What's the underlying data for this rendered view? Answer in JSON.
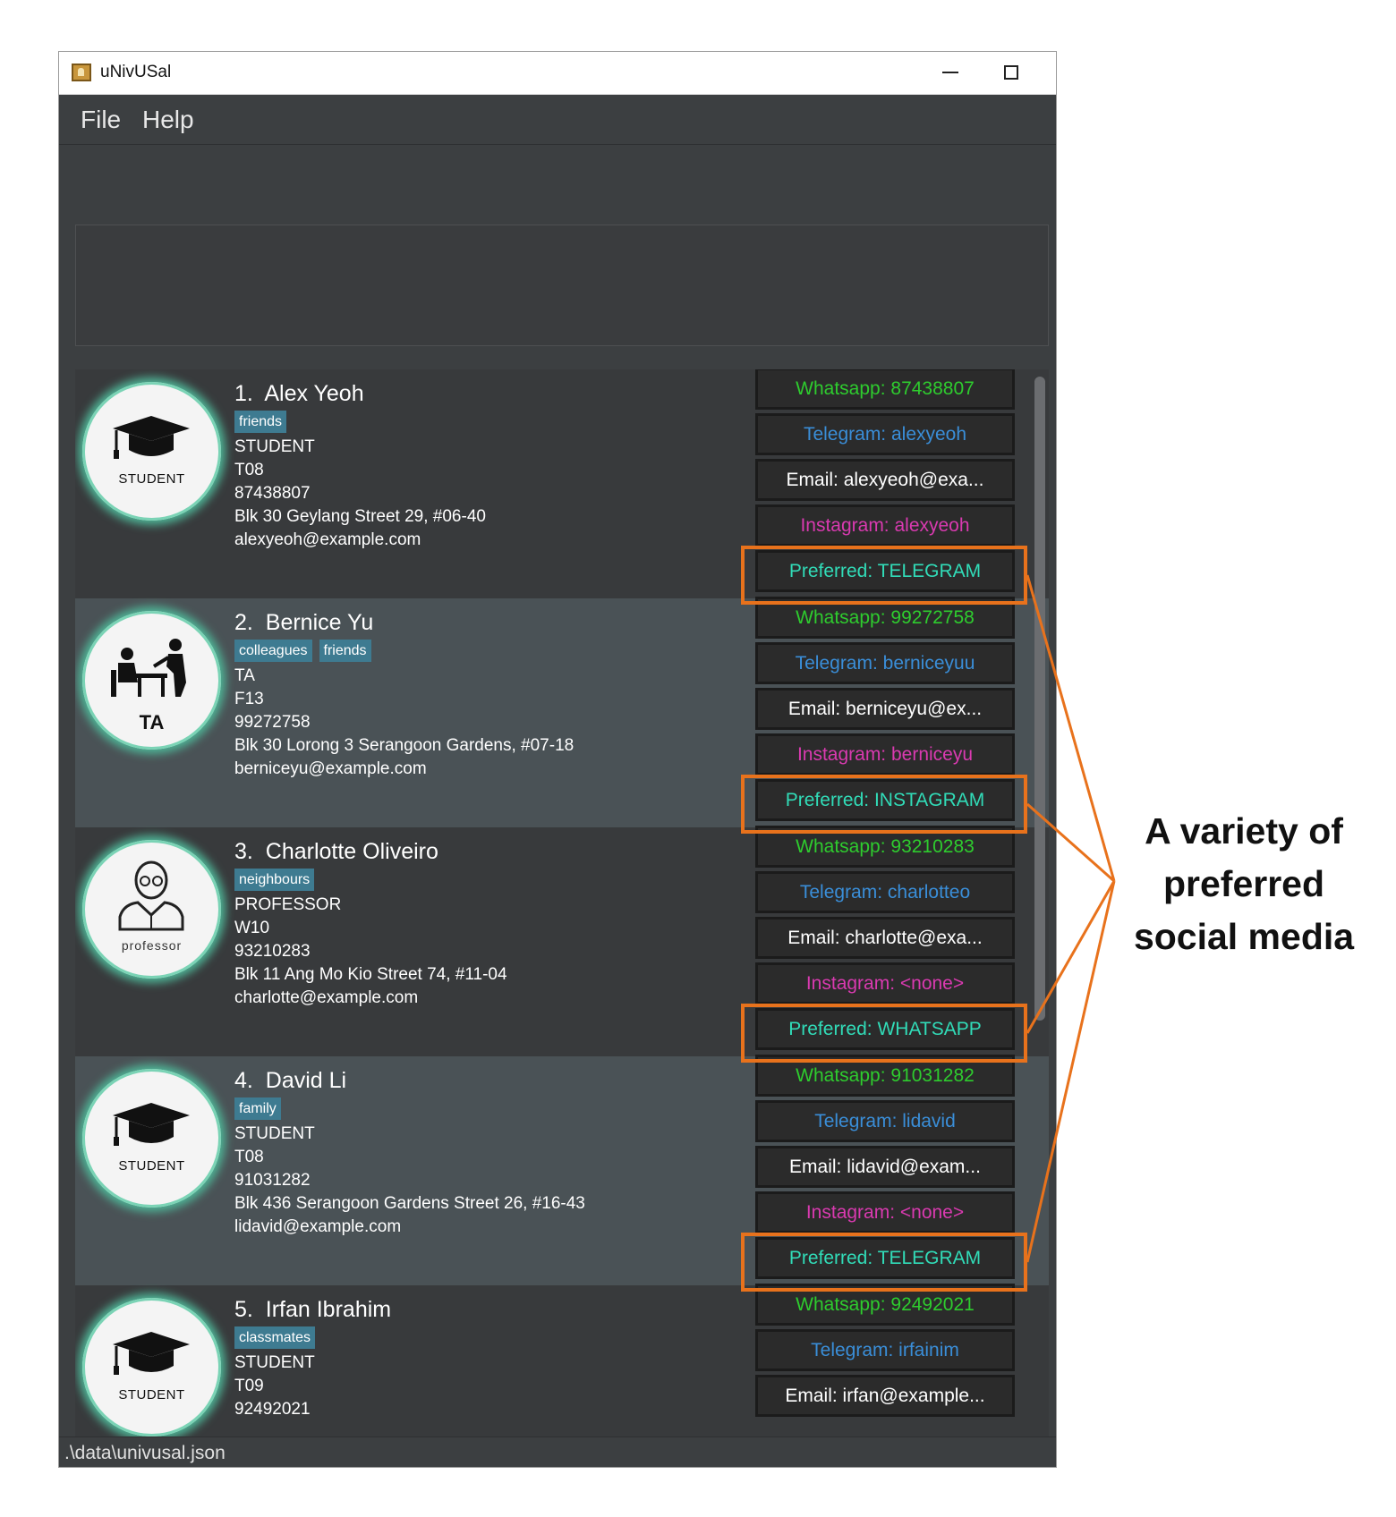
{
  "window": {
    "title": "uNivUSal"
  },
  "menu": {
    "file": "File",
    "help": "Help"
  },
  "contacts": [
    {
      "index": "1.",
      "name": "Alex Yeoh",
      "tags": [
        "friends"
      ],
      "role": "STUDENT",
      "group": "T08",
      "phone": "87438807",
      "address": "Blk 30 Geylang Street 29, #06-40",
      "email": "alexyeoh@example.com",
      "avatar_label": "STUDENT",
      "social": {
        "whatsapp": "Whatsapp: 87438807",
        "telegram": "Telegram: alexyeoh",
        "email": "Email: alexyeoh@exa...",
        "instagram": "Instagram: alexyeoh",
        "preferred": "Preferred: TELEGRAM"
      }
    },
    {
      "index": "2.",
      "name": "Bernice Yu",
      "tags": [
        "colleagues",
        "friends"
      ],
      "role": "TA",
      "group": "F13",
      "phone": "99272758",
      "address": "Blk 30 Lorong 3 Serangoon Gardens, #07-18",
      "email": "berniceyu@example.com",
      "avatar_label": "TA",
      "social": {
        "whatsapp": "Whatsapp: 99272758",
        "telegram": "Telegram: berniceyuu",
        "email": "Email: berniceyu@ex...",
        "instagram": "Instagram: berniceyu",
        "preferred": "Preferred: INSTAGRAM"
      }
    },
    {
      "index": "3.",
      "name": "Charlotte Oliveiro",
      "tags": [
        "neighbours"
      ],
      "role": "PROFESSOR",
      "group": "W10",
      "phone": "93210283",
      "address": "Blk 11 Ang Mo Kio Street 74, #11-04",
      "email": "charlotte@example.com",
      "avatar_label": "professor",
      "social": {
        "whatsapp": "Whatsapp: 93210283",
        "telegram": "Telegram: charlotteo",
        "email": "Email: charlotte@exa...",
        "instagram": "Instagram: <none>",
        "preferred": "Preferred: WHATSAPP"
      }
    },
    {
      "index": "4.",
      "name": "David Li",
      "tags": [
        "family"
      ],
      "role": "STUDENT",
      "group": "T08",
      "phone": "91031282",
      "address": "Blk 436 Serangoon Gardens Street 26, #16-43",
      "email": "lidavid@example.com",
      "avatar_label": "STUDENT",
      "social": {
        "whatsapp": "Whatsapp: 91031282",
        "telegram": "Telegram: lidavid",
        "email": "Email: lidavid@exam...",
        "instagram": "Instagram: <none>",
        "preferred": "Preferred: TELEGRAM"
      }
    },
    {
      "index": "5.",
      "name": "Irfan Ibrahim",
      "tags": [
        "classmates"
      ],
      "role": "STUDENT",
      "group": "T09",
      "phone": "92492021",
      "avatar_label": "STUDENT",
      "social": {
        "whatsapp": "Whatsapp: 92492021",
        "telegram": "Telegram: irfainim",
        "email": "Email: irfan@example..."
      }
    }
  ],
  "status": {
    "path": ".\\data\\univusal.json"
  },
  "annotation": {
    "line1": "A variety of",
    "line2": "preferred",
    "line3": "social media"
  },
  "colors": {
    "highlight": "#e8721c",
    "whatsapp": "#2ecc2e",
    "telegram": "#3a8ed8",
    "instagram": "#d93ab0",
    "preferred": "#31dcb8",
    "tag": "#3e7b91"
  }
}
